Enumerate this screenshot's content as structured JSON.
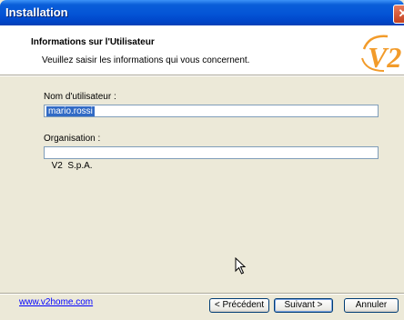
{
  "window": {
    "title": "Installation",
    "close_glyph": "✕"
  },
  "header": {
    "title": "Informations sur l'Utilisateur",
    "subtitle": "Veuillez saisir les informations qui vous concernent.",
    "logo_text": "V2"
  },
  "form": {
    "username_label": "Nom d'utilisateur :",
    "username_value": "mario.rossi",
    "organisation_label": "Organisation :",
    "organisation_value": "V2  S.p.A."
  },
  "footer": {
    "link": "www.v2home.com",
    "back_label": "< Précédent",
    "next_label": "Suivant >",
    "cancel_label": "Annuler"
  },
  "colors": {
    "title_bar": "#0454D6",
    "selection": "#316AC5",
    "logo": "#F29B2A"
  }
}
